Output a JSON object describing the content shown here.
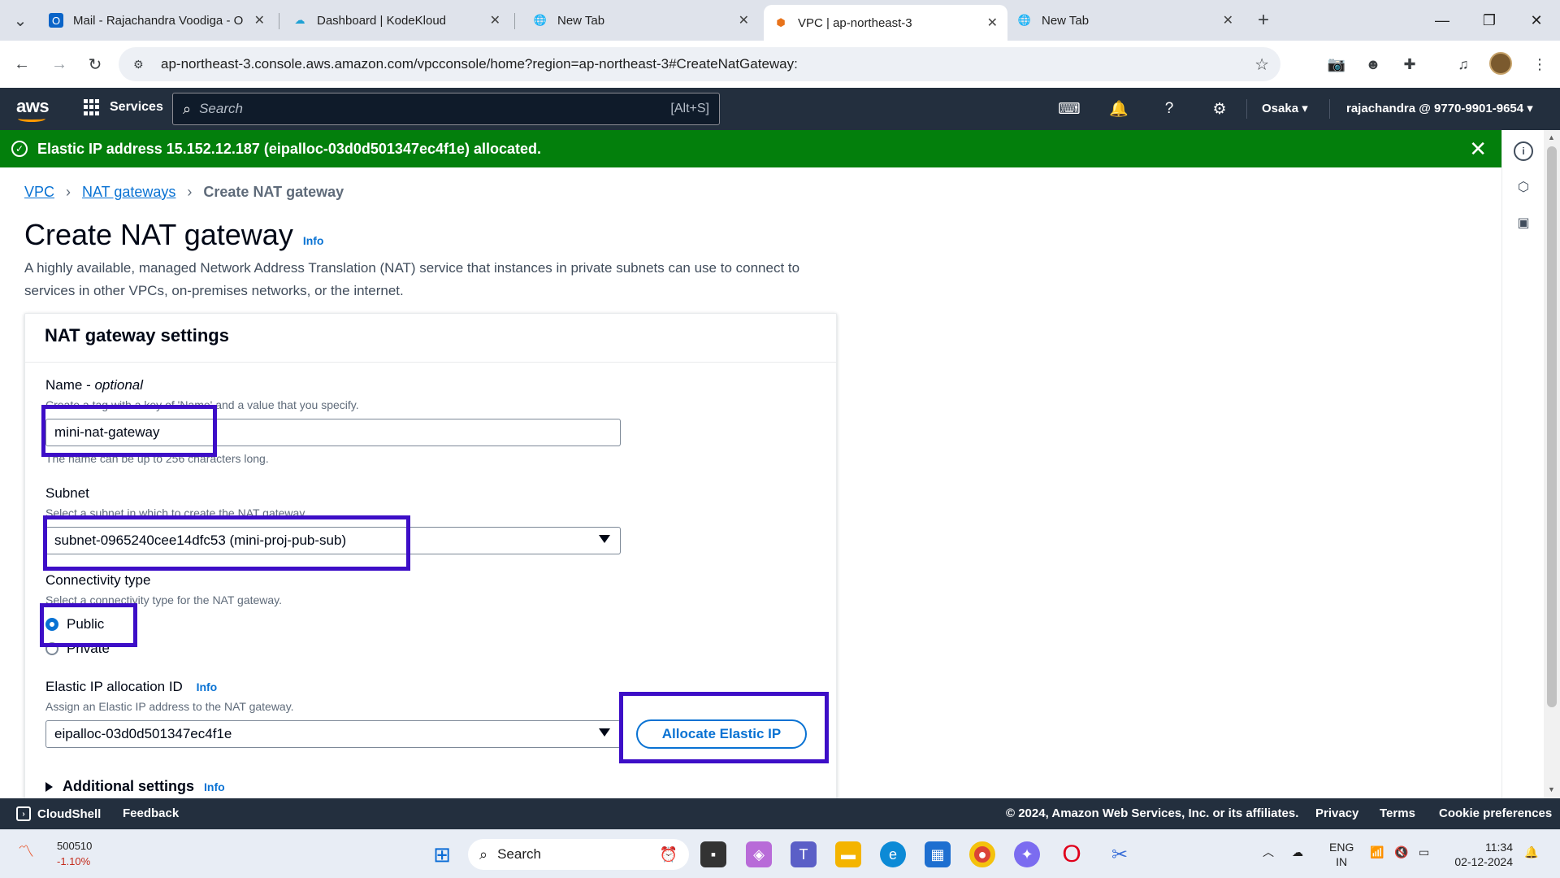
{
  "browser": {
    "tabs": [
      {
        "title": "Mail - Rajachandra Voodiga - O",
        "icon": "outlook-icon"
      },
      {
        "title": "Dashboard | KodeKloud",
        "icon": "kodekloud-icon"
      },
      {
        "title": "New Tab",
        "icon": "globe-icon"
      },
      {
        "title": "VPC | ap-northeast-3",
        "icon": "aws-vpc-icon",
        "active": true
      },
      {
        "title": "New Tab",
        "icon": "globe-icon"
      }
    ],
    "url": "ap-northeast-3.console.aws.amazon.com/vpcconsole/home?region=ap-northeast-3#CreateNatGateway:"
  },
  "aws_nav": {
    "logo": "aws",
    "services_label": "Services",
    "search_placeholder": "Search",
    "search_shortcut": "[Alt+S]",
    "region": "Osaka",
    "account": "rajachandra @ 9770-9901-9654"
  },
  "flash": {
    "message": "Elastic IP address 15.152.12.187 (eipalloc-03d0d501347ec4f1e) allocated.",
    "color": "#037f0c"
  },
  "breadcrumb": {
    "items": [
      "VPC",
      "NAT gateways"
    ],
    "current": "Create NAT gateway"
  },
  "page": {
    "title": "Create NAT gateway",
    "info": "Info",
    "description": "A highly available, managed Network Address Translation (NAT) service that instances in private subnets can use to connect to services in other VPCs, on-premises networks, or the internet."
  },
  "settings": {
    "header": "NAT gateway settings",
    "name": {
      "label": "Name",
      "label_suffix": "optional",
      "description": "Create a tag with a key of 'Name' and a value that you specify.",
      "value": "mini-nat-gateway",
      "constraint": "The name can be up to 256 characters long."
    },
    "subnet": {
      "label": "Subnet",
      "description": "Select a subnet in which to create the NAT gateway.",
      "value": "subnet-0965240cee14dfc53 (mini-proj-pub-sub)"
    },
    "connectivity": {
      "label": "Connectivity type",
      "description": "Select a connectivity type for the NAT gateway.",
      "options": [
        "Public",
        "Private"
      ],
      "selected": "Public"
    },
    "eip": {
      "label": "Elastic IP allocation ID",
      "info": "Info",
      "description": "Assign an Elastic IP address to the NAT gateway.",
      "value": "eipalloc-03d0d501347ec4f1e",
      "button": "Allocate Elastic IP"
    },
    "additional": {
      "label": "Additional settings",
      "info": "Info"
    }
  },
  "aws_footer": {
    "cloudshell": "CloudShell",
    "feedback": "Feedback",
    "copyright": "© 2024, Amazon Web Services, Inc. or its affiliates.",
    "privacy": "Privacy",
    "terms": "Terms",
    "cookie": "Cookie preferences"
  },
  "taskbar": {
    "stock_value": "500510",
    "stock_change": "-1.10%",
    "search": "Search",
    "lang_line1": "ENG",
    "lang_line2": "IN",
    "time": "11:34",
    "date": "02-12-2024"
  },
  "highlight_color": "#3d0ec7"
}
